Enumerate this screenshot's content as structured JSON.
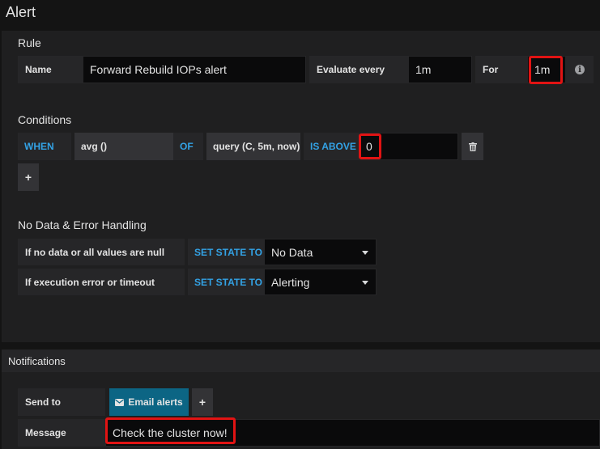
{
  "page": {
    "title": "Alert"
  },
  "rule": {
    "section_title": "Rule",
    "name_label": "Name",
    "name_value": "Forward Rebuild IOPs alert",
    "evaluate_label": "Evaluate every",
    "evaluate_value": "1m",
    "for_label": "For",
    "for_value": "1m",
    "info_icon": "i"
  },
  "conditions": {
    "section_title": "Conditions",
    "when": "WHEN",
    "reducer": "avg ()",
    "of": "OF",
    "query": "query (C, 5m, now)",
    "evaluator": "IS ABOVE",
    "threshold": "0",
    "add": "+"
  },
  "no_data": {
    "section_title": "No Data & Error Handling",
    "row1_label": "If no data or all values are null",
    "row1_kw": "SET STATE TO",
    "row1_value": "No Data",
    "row2_label": "If execution error or timeout",
    "row2_kw": "SET STATE TO",
    "row2_value": "Alerting"
  },
  "notifications": {
    "section_title": "Notifications",
    "send_to_label": "Send to",
    "email_label": "Email alerts",
    "add": "+",
    "message_label": "Message",
    "message_value": "Check the cluster now!"
  },
  "colors": {
    "accent": "#33a2e5",
    "highlight": "#e11313",
    "notification_button": "#0c6584"
  }
}
